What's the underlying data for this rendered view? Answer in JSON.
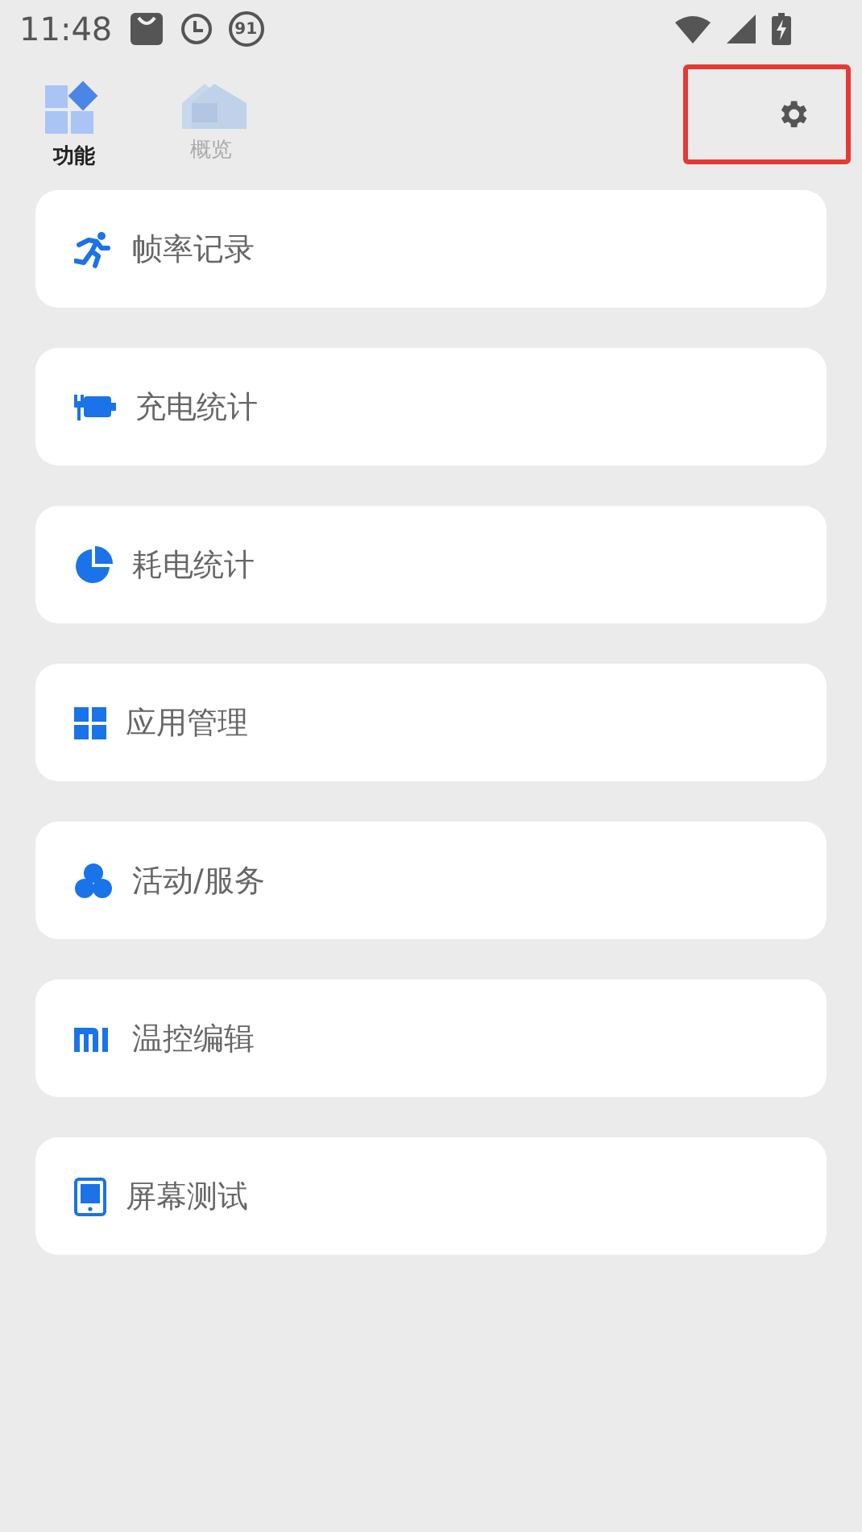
{
  "status_bar": {
    "time": "11:48",
    "notification_badge": "91"
  },
  "tabs": [
    {
      "label": "功能",
      "kind": "grid",
      "selected": true
    },
    {
      "label": "概览",
      "kind": "home",
      "selected": false
    }
  ],
  "settings": {
    "highlighted": true
  },
  "items": [
    {
      "label": "帧率记录",
      "kind": "run"
    },
    {
      "label": "充电统计",
      "kind": "charge"
    },
    {
      "label": "耗电统计",
      "kind": "pie"
    },
    {
      "label": "应用管理",
      "kind": "apps"
    },
    {
      "label": "活动/服务",
      "kind": "circles"
    },
    {
      "label": "温控编辑",
      "kind": "mi"
    },
    {
      "label": "屏幕测试",
      "kind": "screen"
    }
  ]
}
